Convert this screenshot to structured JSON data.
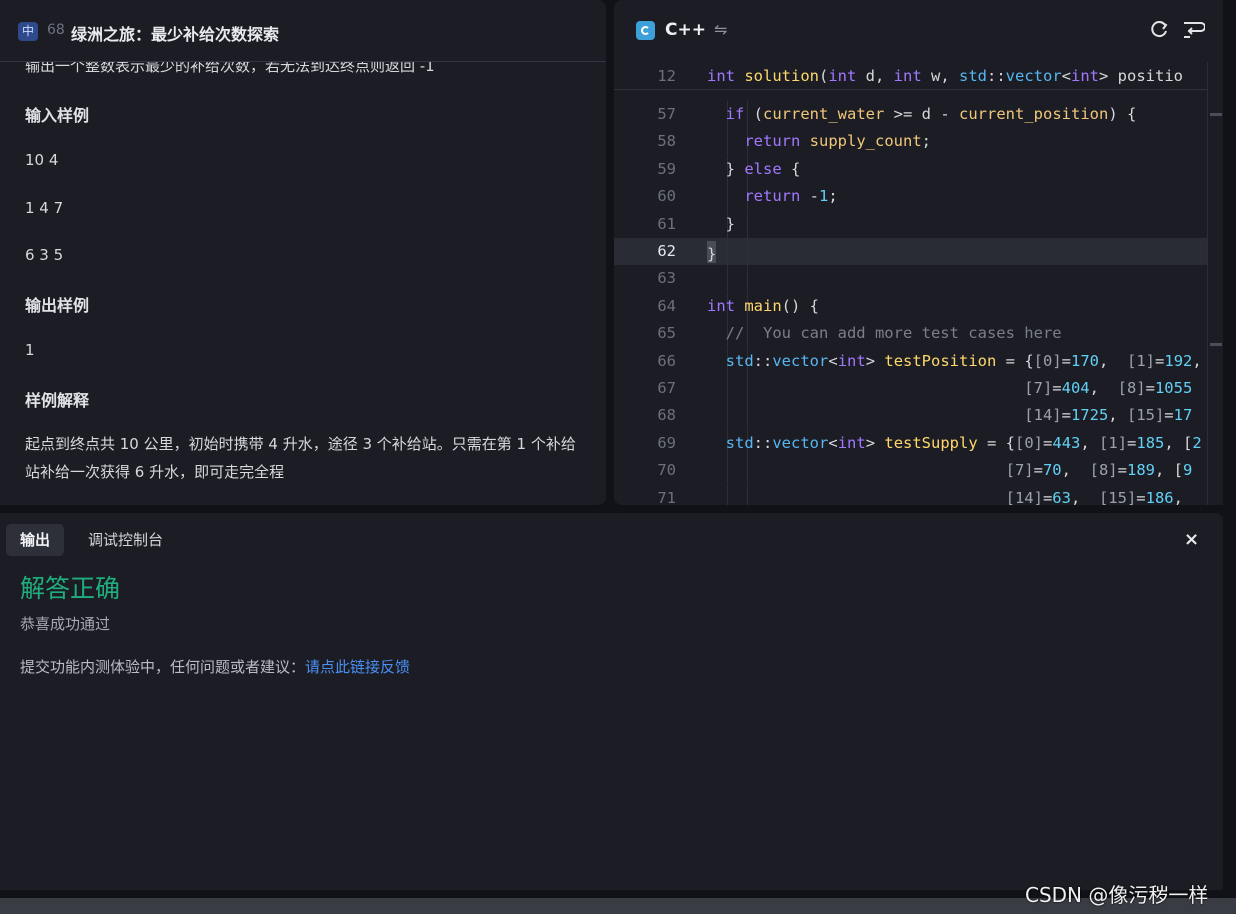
{
  "problem": {
    "lang_badge": "中",
    "number": "68",
    "title": "绿洲之旅：最少补给次数探索",
    "partial_line": "输出一个整数表示最少的补给次数，若无法到达终点则返回 -1",
    "input_heading": "输入样例",
    "input_lines": [
      "10 4",
      "1 4 7",
      "6 3 5"
    ],
    "output_heading": "输出样例",
    "output_value": "1",
    "explain_heading": "样例解释",
    "explain_text": "起点到终点共 10 公里，初始时携带 4 升水，途径 3 个补给站。只需在第 1 个补给站补给一次获得 6 升水，即可走完全程"
  },
  "editor": {
    "language": "C++",
    "swap_icon": "⇋",
    "icons": [
      "cpp-icon",
      "swap-icon",
      "refresh-icon",
      "wrap-icon"
    ],
    "sticky": {
      "ln": "12",
      "code": "int solution(int d, int w, std::vector<int> positio"
    },
    "lines": [
      {
        "ln": "57",
        "code": "  if (current_water >= d - current_position) {"
      },
      {
        "ln": "58",
        "code": "    return supply_count;"
      },
      {
        "ln": "59",
        "code": "  } else {"
      },
      {
        "ln": "60",
        "code": "    return -1;"
      },
      {
        "ln": "61",
        "code": "  }"
      },
      {
        "ln": "62",
        "code": "}"
      },
      {
        "ln": "63",
        "code": ""
      },
      {
        "ln": "64",
        "code": "int main() {"
      },
      {
        "ln": "65",
        "code": "  //  You can add more test cases here"
      },
      {
        "ln": "66",
        "code": "  std::vector<int> testPosition = {[0]=170,  [1]=192,"
      },
      {
        "ln": "67",
        "code": "                                  [7]=404,  [8]=1055"
      },
      {
        "ln": "68",
        "code": "                                  [14]=1725, [15]=17"
      },
      {
        "ln": "69",
        "code": "  std::vector<int> testSupply = {[0]=443, [1]=185, [2"
      },
      {
        "ln": "70",
        "code": "                                [7]=70,  [8]=189, [9"
      },
      {
        "ln": "71",
        "code": "                                [14]=63,  [15]=186,"
      }
    ],
    "active_line": "62"
  },
  "output": {
    "tabs": [
      "输出",
      "调试控制台"
    ],
    "active_tab": "输出",
    "close_icon": "×",
    "result_title": "解答正确",
    "result_sub": "恭喜成功通过",
    "feedback_prefix": "提交功能内测体验中，任何问题或者建议：",
    "feedback_link": "请点此链接反馈"
  },
  "watermark": "CSDN @像污秽一样",
  "colors": {
    "success": "#1fae7e",
    "link": "#4a8ff3",
    "keyword": "#a277ff",
    "type": "#56b6f0",
    "function": "#ffd86b",
    "number": "#61d0f4"
  }
}
